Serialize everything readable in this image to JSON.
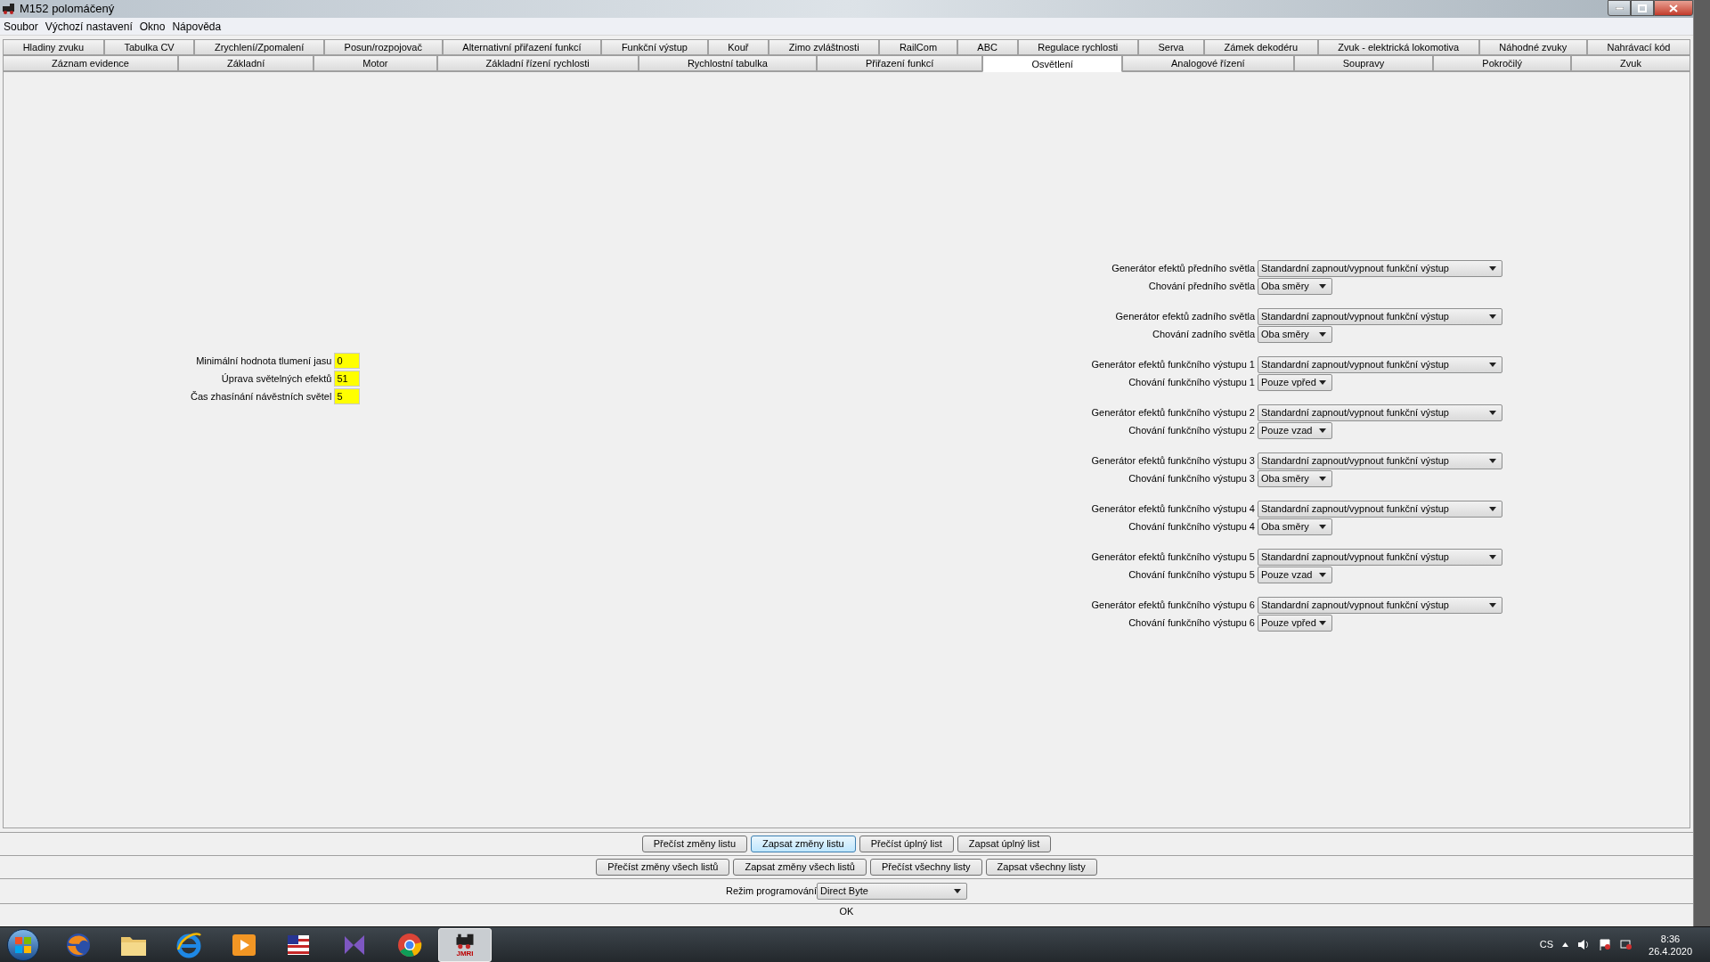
{
  "window": {
    "title": "M152 polomáčený"
  },
  "menu": [
    "Soubor",
    "Výchozí nastavení",
    "Okno",
    "Nápověda"
  ],
  "tabs_row1": [
    {
      "label": "Hladiny zvuku",
      "selected": false
    },
    {
      "label": "Tabulka CV",
      "selected": false
    },
    {
      "label": "Zrychlení/Zpomalení",
      "selected": false
    },
    {
      "label": "Posun/rozpojovač",
      "selected": false
    },
    {
      "label": "Alternativní přiřazení funkcí",
      "selected": false
    },
    {
      "label": "Funkční výstup",
      "selected": false
    },
    {
      "label": "Kouř",
      "selected": false
    },
    {
      "label": "Zimo zvláštnosti",
      "selected": false
    },
    {
      "label": "RailCom",
      "selected": false
    },
    {
      "label": "ABC",
      "selected": false
    },
    {
      "label": "Regulace rychlosti",
      "selected": false
    },
    {
      "label": "Serva",
      "selected": false
    },
    {
      "label": "Zámek dekodéru",
      "selected": false
    },
    {
      "label": "Zvuk - elektrická lokomotiva",
      "selected": false
    },
    {
      "label": "Náhodné zvuky",
      "selected": false
    },
    {
      "label": "Nahrávací kód",
      "selected": false
    }
  ],
  "tabs_row2": [
    {
      "label": "Záznam evidence",
      "selected": false
    },
    {
      "label": "Základní",
      "selected": false
    },
    {
      "label": "Motor",
      "selected": false
    },
    {
      "label": "Základní řízení rychlosti",
      "selected": false
    },
    {
      "label": "Rychlostní tabulka",
      "selected": false
    },
    {
      "label": "Přiřazení funkcí",
      "selected": false
    },
    {
      "label": "Osvětlení",
      "selected": true
    },
    {
      "label": "Analogové řízení",
      "selected": false
    },
    {
      "label": "Soupravy",
      "selected": false
    },
    {
      "label": "Pokročilý",
      "selected": false
    },
    {
      "label": "Zvuk",
      "selected": false
    }
  ],
  "fields_left": [
    {
      "label": "Minimální hodnota tlumení jasu",
      "value": "0"
    },
    {
      "label": "Úprava světelných efektů",
      "value": "51"
    },
    {
      "label": "Čas zhasínání návěstních světel",
      "value": "5"
    }
  ],
  "fields_right": [
    {
      "label": "Generátor efektů předního světla",
      "value": "Standardní zapnout/vypnout funkční výstup",
      "kind": "wide"
    },
    {
      "label": "Chování předního světla",
      "value": "Oba směry",
      "kind": "narrow"
    },
    {
      "label": "Generátor efektů zadního světla",
      "value": "Standardní zapnout/vypnout funkční výstup",
      "kind": "wide"
    },
    {
      "label": "Chování zadního světla",
      "value": "Oba směry",
      "kind": "narrow"
    },
    {
      "label": "Generátor efektů funkčního výstupu 1",
      "value": "Standardní zapnout/vypnout funkční výstup",
      "kind": "wide"
    },
    {
      "label": "Chování funkčního výstupu 1",
      "value": "Pouze vpřed",
      "kind": "narrow"
    },
    {
      "label": "Generátor efektů funkčního výstupu 2",
      "value": "Standardní zapnout/vypnout funkční výstup",
      "kind": "wide"
    },
    {
      "label": "Chování funkčního výstupu 2",
      "value": "Pouze vzad",
      "kind": "narrow"
    },
    {
      "label": "Generátor efektů funkčního výstupu 3",
      "value": "Standardní zapnout/vypnout funkční výstup",
      "kind": "wide"
    },
    {
      "label": "Chování funkčního výstupu 3",
      "value": "Oba směry",
      "kind": "narrow"
    },
    {
      "label": "Generátor efektů funkčního výstupu 4",
      "value": "Standardní zapnout/vypnout funkční výstup",
      "kind": "wide"
    },
    {
      "label": "Chování funkčního výstupu 4",
      "value": "Oba směry",
      "kind": "narrow"
    },
    {
      "label": "Generátor efektů funkčního výstupu 5",
      "value": "Standardní zapnout/vypnout funkční výstup",
      "kind": "wide"
    },
    {
      "label": "Chování funkčního výstupu 5",
      "value": "Pouze vzad",
      "kind": "narrow"
    },
    {
      "label": "Generátor efektů funkčního výstupu 6",
      "value": "Standardní zapnout/vypnout funkční výstup",
      "kind": "wide"
    },
    {
      "label": "Chování funkčního výstupu 6",
      "value": "Pouze vpřed",
      "kind": "narrow"
    }
  ],
  "buttons_row1": [
    {
      "label": "Přečíst změny listu",
      "focused": false
    },
    {
      "label": "Zapsat změny listu",
      "focused": true
    },
    {
      "label": "Přečíst úplný list",
      "focused": false
    },
    {
      "label": "Zapsat úplný list",
      "focused": false
    }
  ],
  "buttons_row2": [
    {
      "label": "Přečíst změny všech listů",
      "focused": false
    },
    {
      "label": "Zapsat změny všech listů",
      "focused": false
    },
    {
      "label": "Přečíst všechny listy",
      "focused": false
    },
    {
      "label": "Zapsat všechny listy",
      "focused": false
    }
  ],
  "programming_mode": {
    "label": "Režim programování",
    "value": "Direct Byte"
  },
  "status": "OK",
  "taskbar": {
    "apps": [
      {
        "kind": "fox",
        "active": false
      },
      {
        "kind": "folder",
        "active": false
      },
      {
        "kind": "letter-e",
        "active": false
      },
      {
        "kind": "play",
        "active": false
      },
      {
        "kind": "flag",
        "active": false
      },
      {
        "kind": "bow",
        "active": false
      },
      {
        "kind": "ring",
        "active": false
      },
      {
        "kind": "train",
        "active": true,
        "label": "JMRI"
      }
    ],
    "language": "CS",
    "time": "8:36",
    "date": "26.4.2020"
  }
}
